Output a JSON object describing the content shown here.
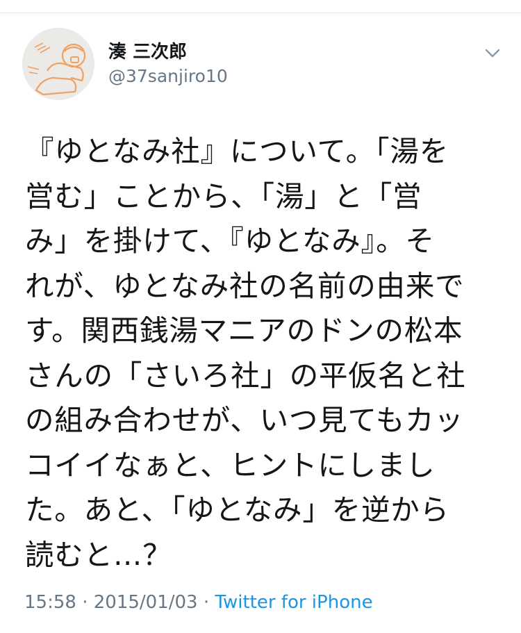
{
  "author": {
    "display_name": "湊 三次郎",
    "handle": "@37sanjiro10",
    "avatar": {
      "icon": "avatar-illustration",
      "accent_color": "#f0a060"
    }
  },
  "menu": {
    "icon": "chevron-down-icon"
  },
  "tweet": {
    "text": "『ゆとなみ社』について。「湯を\n営む」ことから、「湯」と「営\nみ」を掛けて、『ゆとなみ』。そ\nれが、ゆとなみ社の名前の由来で\nす。関西銭湯マニアのドンの松本\nさんの「さいろ社」の平仮名と社\nの組み合わせが、いつ見てもカッ\nコイイなぁと、ヒントにしまし\nた。あと、「ゆとなみ」を逆から\n読むと…？"
  },
  "meta": {
    "time": "15:58",
    "separator": " · ",
    "date": "2015/01/03",
    "source": "Twitter for iPhone"
  },
  "colors": {
    "text": "#14171a",
    "secondary": "#657786",
    "link": "#1b95e0",
    "divider": "#e1e8ed"
  }
}
